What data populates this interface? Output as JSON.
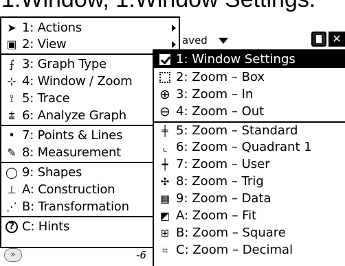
{
  "caption": "1:Window, 1:Window Settings.",
  "screen": {
    "doc_label": "aved",
    "axis_label": "-6",
    "scratchpad_glyph": "»"
  },
  "menu": {
    "items": [
      {
        "label": "1: Actions",
        "icon": "cursor-arrow-icon",
        "glyph": "➤",
        "has_submenu": true
      },
      {
        "label": "2: View",
        "icon": "view-icon",
        "glyph": "▣",
        "has_submenu": true
      },
      {
        "label": "3: Graph Type",
        "icon": "graph-type-icon",
        "glyph": "⨍",
        "has_submenu": true
      },
      {
        "label": "4: Window / Zoom",
        "icon": "window-zoom-icon",
        "glyph": "⊹",
        "has_submenu": true
      },
      {
        "label": "5: Trace",
        "icon": "trace-icon",
        "glyph": "⟟",
        "has_submenu": true
      },
      {
        "label": "6: Analyze Graph",
        "icon": "analyze-graph-icon",
        "glyph": "⩲",
        "has_submenu": true
      },
      {
        "label": "7: Points & Lines",
        "icon": "points-lines-icon",
        "glyph": "·",
        "has_submenu": true
      },
      {
        "label": "8: Measurement",
        "icon": "ruler-icon",
        "glyph": "✎",
        "has_submenu": true
      },
      {
        "label": "9: Shapes",
        "icon": "shapes-icon",
        "glyph": "◯",
        "has_submenu": true
      },
      {
        "label": "A: Construction",
        "icon": "construction-icon",
        "glyph": "⊥",
        "has_submenu": true
      },
      {
        "label": "B: Transformation",
        "icon": "transformation-icon",
        "glyph": "⋰",
        "has_submenu": true
      },
      {
        "label": "C: Hints",
        "icon": "help-icon",
        "glyph": "?",
        "has_submenu": false
      }
    ]
  },
  "submenu": {
    "items": [
      {
        "label": "1: Window Settings",
        "icon": "checkbox-icon",
        "selected": true
      },
      {
        "label": "2: Zoom – Box",
        "icon": "zoom-box-icon",
        "glyph": "",
        "selected": false
      },
      {
        "label": "3: Zoom – In",
        "icon": "zoom-in-icon",
        "glyph": "⊕",
        "selected": false
      },
      {
        "label": "4: Zoom – Out",
        "icon": "zoom-out-icon",
        "glyph": "⊖",
        "selected": false
      },
      {
        "label": "5: Zoom – Standard",
        "icon": "zoom-standard-icon",
        "glyph": "╪",
        "selected": false
      },
      {
        "label": "6: Zoom – Quadrant 1",
        "icon": "zoom-quadrant-icon",
        "glyph": "⌞",
        "selected": false
      },
      {
        "label": "7: Zoom – User",
        "icon": "zoom-user-icon",
        "glyph": "┿",
        "selected": false
      },
      {
        "label": "8: Zoom – Trig",
        "icon": "zoom-trig-icon",
        "glyph": "✣",
        "selected": false
      },
      {
        "label": "9: Zoom – Data",
        "icon": "zoom-data-icon",
        "glyph": "▦",
        "selected": false
      },
      {
        "label": "A: Zoom – Fit",
        "icon": "zoom-fit-icon",
        "glyph": "◩",
        "selected": false
      },
      {
        "label": "B: Zoom – Square",
        "icon": "zoom-square-icon",
        "glyph": "⊞",
        "selected": false
      },
      {
        "label": "C: Zoom – Decimal",
        "icon": "zoom-decimal-icon",
        "glyph": "⌗",
        "selected": false
      }
    ]
  }
}
